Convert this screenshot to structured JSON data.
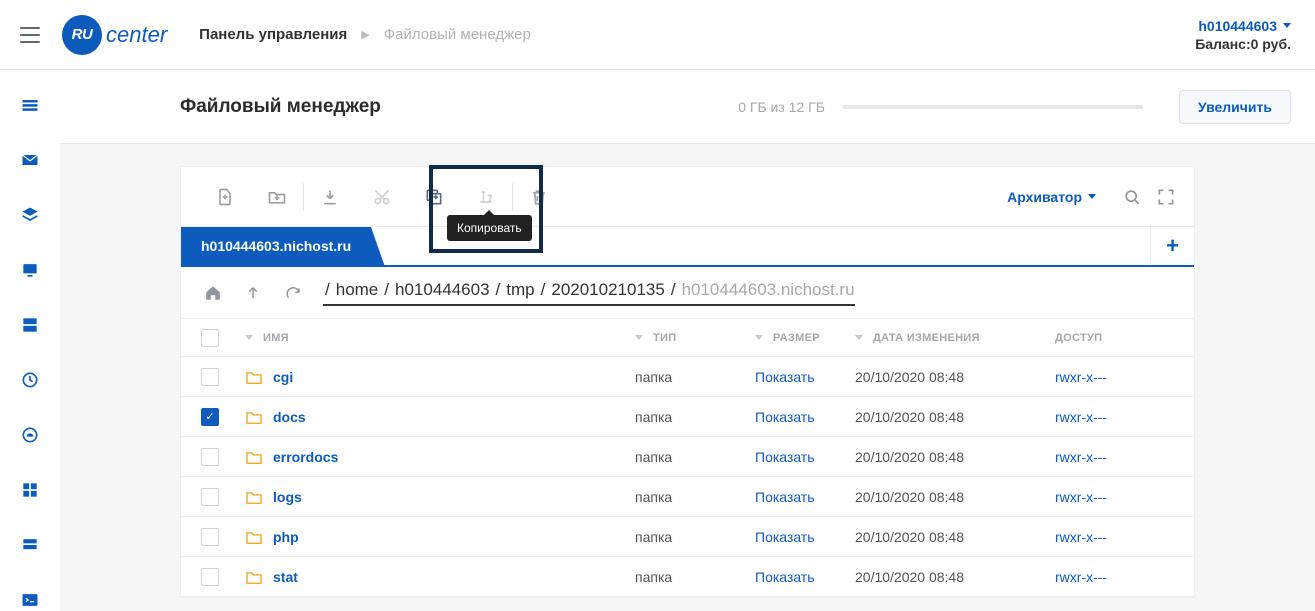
{
  "header": {
    "logo_badge": "RU",
    "logo_text": "center",
    "breadcrumb_main": "Панель управления",
    "breadcrumb_current": "Файловый менеджер",
    "account_id": "h010444603",
    "balance_label": "Баланс:0 руб."
  },
  "subheader": {
    "title": "Файловый менеджер",
    "usage_text": "0 ГБ из 12 ГБ",
    "upgrade_button": "Увеличить"
  },
  "toolbar": {
    "copy_tooltip": "Копировать",
    "archiver_label": "Архиватор"
  },
  "tabs": {
    "active": "h010444603.nichost.ru"
  },
  "path": {
    "segments": [
      "home",
      "h010444603",
      "tmp",
      "202010210135",
      "h010444603.nichost.ru"
    ]
  },
  "table": {
    "headers": {
      "name": "ИМЯ",
      "type": "ТИП",
      "size": "РАЗМЕР",
      "date": "ДАТА ИЗМЕНЕНИЯ",
      "perm": "ДОСТУП"
    },
    "type_folder": "папка",
    "size_show": "Показать",
    "rows": [
      {
        "name": "cgi",
        "type": "папка",
        "date": "20/10/2020 08:48",
        "perm": "rwxr-x---",
        "checked": false
      },
      {
        "name": "docs",
        "type": "папка",
        "date": "20/10/2020 08:48",
        "perm": "rwxr-x---",
        "checked": true
      },
      {
        "name": "errordocs",
        "type": "папка",
        "date": "20/10/2020 08:48",
        "perm": "rwxr-x---",
        "checked": false
      },
      {
        "name": "logs",
        "type": "папка",
        "date": "20/10/2020 08:48",
        "perm": "rwxr-x---",
        "checked": false
      },
      {
        "name": "php",
        "type": "папка",
        "date": "20/10/2020 08:48",
        "perm": "rwxr-x---",
        "checked": false
      },
      {
        "name": "stat",
        "type": "папка",
        "date": "20/10/2020 08:48",
        "perm": "rwxr-x---",
        "checked": false
      }
    ]
  }
}
